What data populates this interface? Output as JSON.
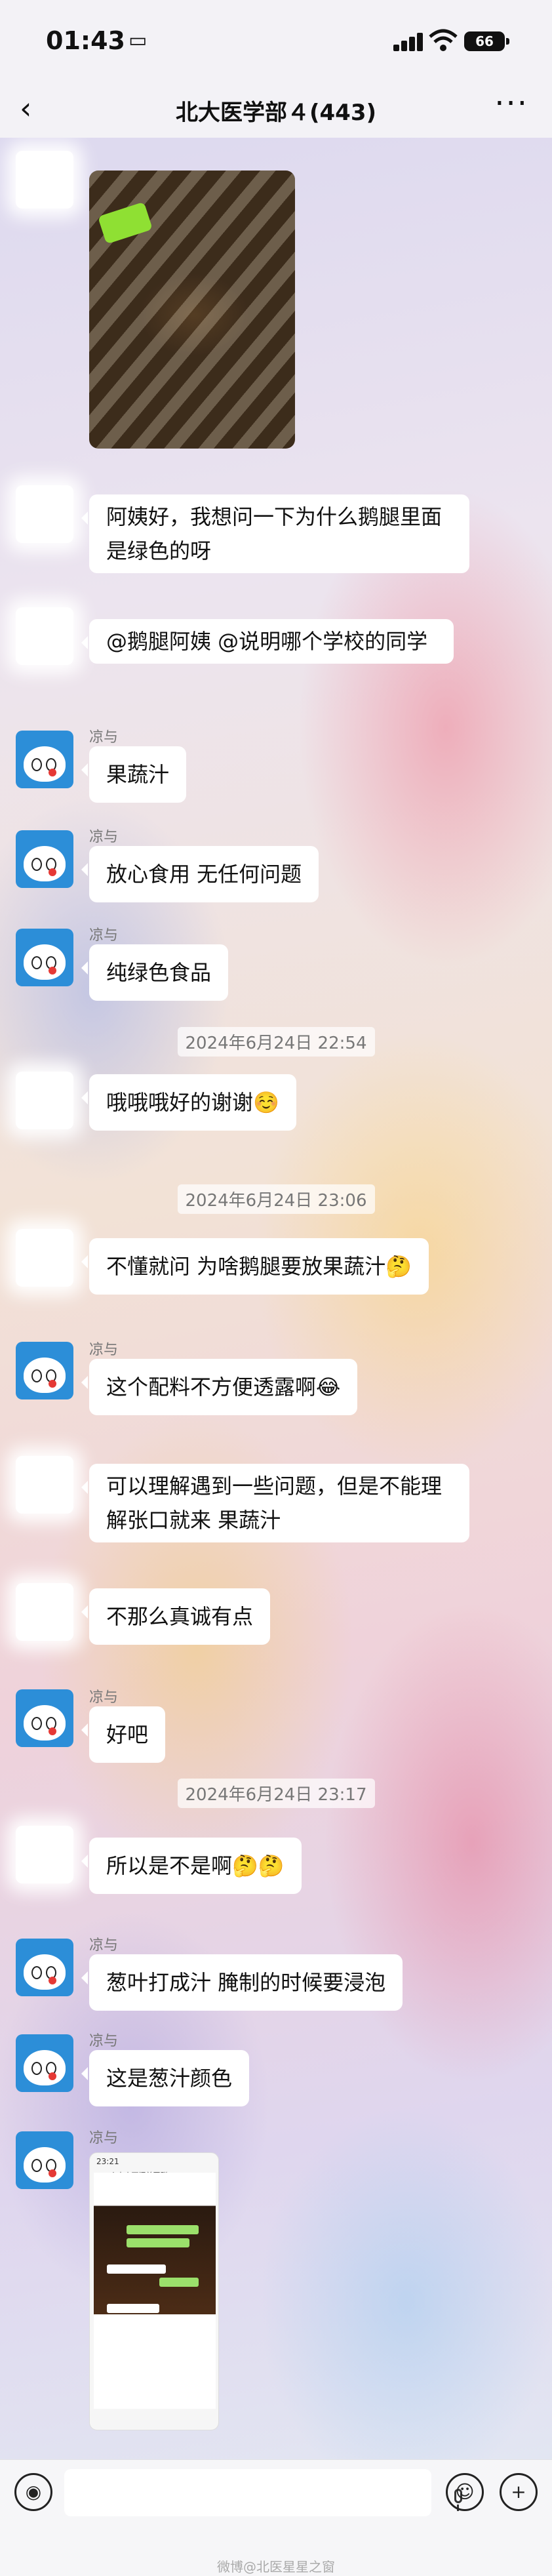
{
  "status": {
    "time": "01:43",
    "battery": "66"
  },
  "header": {
    "title": "北大医学部４(443)",
    "back_label": "‹",
    "more_label": "···"
  },
  "messages": {
    "m1": "阿姨好，我想问一下为什么鹅腿里面是绿色的呀",
    "m2": "@鹅腿阿姨 @说明哪个学校的同学",
    "m3": "果蔬汁",
    "m4": "放心食用 无任何问题",
    "m5": "纯绿色食品",
    "m6": "哦哦哦好的谢谢☺️",
    "m7": "不懂就问 为啥鹅腿要放果蔬汁🤔",
    "m8": "这个配料不方便透露啊😂",
    "m9": "可以理解遇到一些问题，但是不能理解张口就来 果蔬汁",
    "m10": "不那么真诚有点",
    "m11": "好吧",
    "m12": "所以是不是啊🤔🤔",
    "m13": "葱叶打成汁 腌制的时候要浸泡",
    "m14": "这是葱汁颜色"
  },
  "sender": {
    "name": "凉与"
  },
  "stamps": {
    "s1": "2024年6月24日 22:54",
    "s2": "2024年6月24日 23:06",
    "s3": "2024年6月24日 23:17"
  },
  "screenshot": {
    "time": "23:21",
    "title": "人大小西门美团群(18,009)"
  },
  "input": {
    "voice_label": "◉",
    "emoji_label": "☺",
    "plus_label": "+"
  },
  "watermark": "微博@北医星星之窗"
}
